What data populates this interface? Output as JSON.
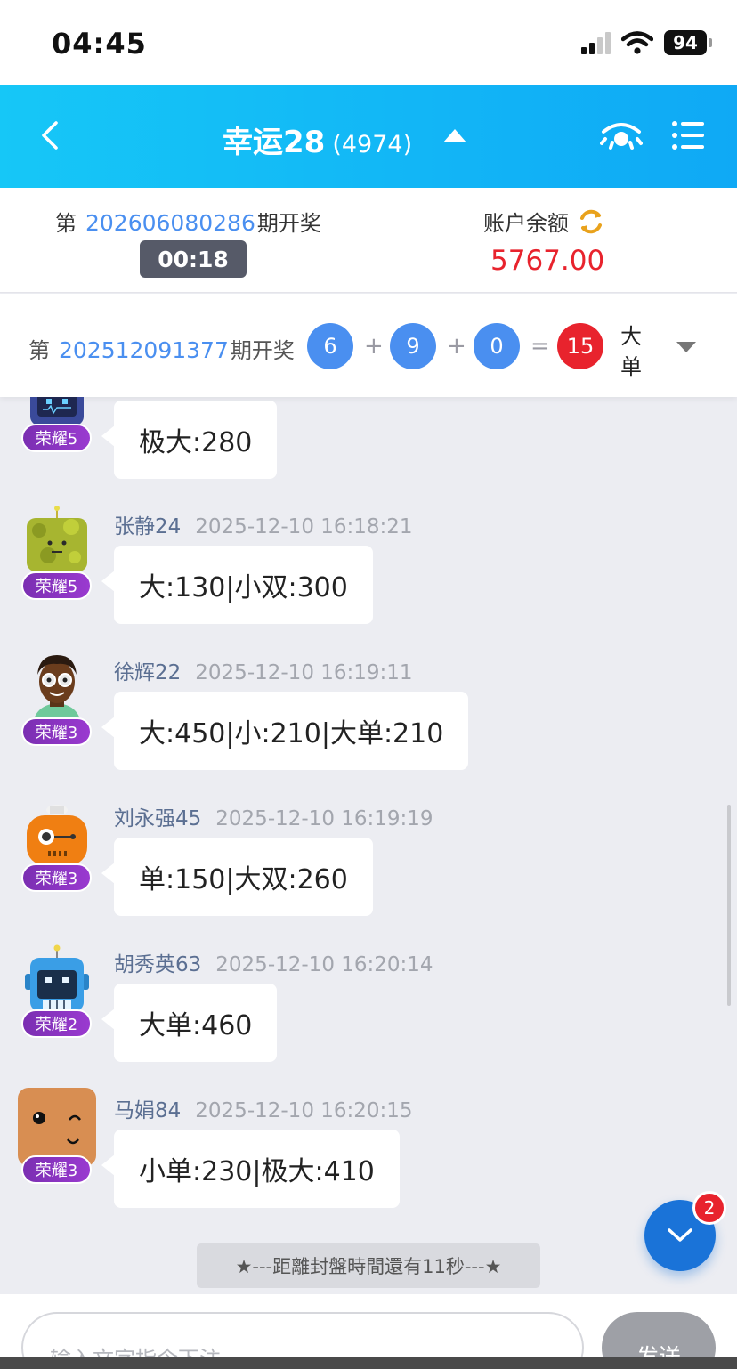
{
  "status_bar": {
    "time": "04:45",
    "battery": "94"
  },
  "header": {
    "title": "幸运28",
    "online_count": "(4974)"
  },
  "current_issue": {
    "prefix": "第",
    "number": "202606080286",
    "suffix": "期开奖",
    "countdown": "00:18",
    "balance_label": "账户余额",
    "balance": "5767.00"
  },
  "last_result": {
    "prefix": "第",
    "number": "202512091377",
    "suffix": "期开奖",
    "n1": "6",
    "n2": "9",
    "n3": "0",
    "plus": "+",
    "equals": "=",
    "sum": "15",
    "tag1": "大",
    "tag2": "单"
  },
  "messages": [
    {
      "name": "",
      "time": "",
      "badge": "荣耀5",
      "text": "极大:280"
    },
    {
      "name": "张静24",
      "time": "2025-12-10 16:18:21",
      "badge": "荣耀5",
      "text": "大:130|小双:300"
    },
    {
      "name": "徐辉22",
      "time": "2025-12-10 16:19:11",
      "badge": "荣耀3",
      "text": "大:450|小:210|大单:210"
    },
    {
      "name": "刘永强45",
      "time": "2025-12-10 16:19:19",
      "badge": "荣耀3",
      "text": "单:150|大双:260"
    },
    {
      "name": "胡秀英63",
      "time": "2025-12-10 16:20:14",
      "badge": "荣耀2",
      "text": "大单:460"
    },
    {
      "name": "马娟84",
      "time": "2025-12-10 16:20:15",
      "badge": "荣耀3",
      "text": "小单:230|极大:410"
    }
  ],
  "notice": "★---距離封盤時間還有11秒---★",
  "unread_count": "2",
  "input": {
    "placeholder": "输入文字指令下注",
    "send_label": "发送"
  },
  "colors": {
    "header": "#16c7f7",
    "accent_blue": "#4a8ff0",
    "accent_red": "#e8232d",
    "badge": "#8a35c2"
  }
}
